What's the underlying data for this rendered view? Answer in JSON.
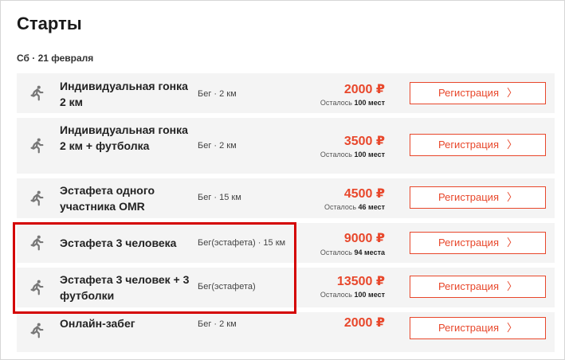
{
  "page": {
    "title": "Старты",
    "date": "Сб · 21 февраля"
  },
  "colors": {
    "accent": "#e8472b",
    "highlight": "#d40000",
    "row_bg": "#f4f4f4"
  },
  "icons": {
    "runner": "running-person-icon",
    "chevron": "chevron-right-icon"
  },
  "starts": [
    {
      "name": "Индивидуальная гонка 2 км",
      "type": "Бег · 2 км",
      "price": "2000 ₽",
      "left_prefix": "Осталось",
      "left_count": "100 мест",
      "button": "Регистрация"
    },
    {
      "name": "Индивидуальная гонка 2 км + футболка",
      "type": "Бег · 2 км",
      "price": "3500 ₽",
      "left_prefix": "Осталось",
      "left_count": "100 мест",
      "button": "Регистрация"
    },
    {
      "name": "Эстафета одного участника OMR",
      "type": "Бег · 15 км",
      "price": "4500 ₽",
      "left_prefix": "Осталось",
      "left_count": "46 мест",
      "button": "Регистрация"
    },
    {
      "name": "Эстафета 3 человека",
      "type": "Бег(эстафета) · 15 км",
      "price": "9000 ₽",
      "left_prefix": "Осталось",
      "left_count": "94 места",
      "button": "Регистрация"
    },
    {
      "name": "Эстафета 3 человек + 3 футболки",
      "type": "Бег(эстафета)",
      "price": "13500 ₽",
      "left_prefix": "Осталось",
      "left_count": "100 мест",
      "button": "Регистрация"
    },
    {
      "name": "Онлайн-забег",
      "type": "Бег · 2 км",
      "price": "2000 ₽",
      "left_prefix": "",
      "left_count": "",
      "button": "Регистрация"
    }
  ]
}
